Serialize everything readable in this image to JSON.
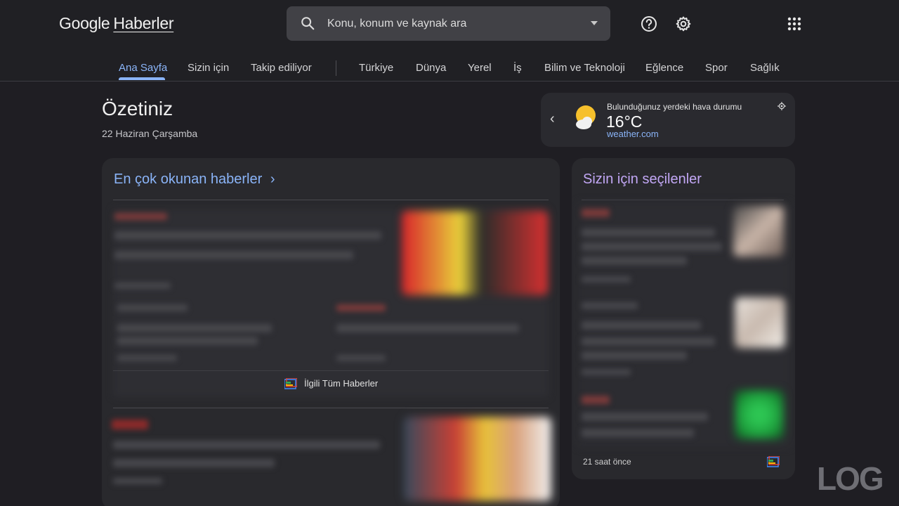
{
  "header": {
    "logo_main": "Google",
    "logo_sub": "Haberler",
    "search_placeholder": "Konu, konum ve kaynak ara",
    "help_icon": "help-circle-icon",
    "settings_icon": "gear-icon",
    "apps_icon": "apps-grid-icon"
  },
  "tabs": [
    {
      "label": "Ana Sayfa",
      "active": true
    },
    {
      "label": "Sizin için"
    },
    {
      "label": "Takip ediliyor"
    },
    {
      "label": "Türkiye"
    },
    {
      "label": "Dünya"
    },
    {
      "label": "Yerel"
    },
    {
      "label": "İş"
    },
    {
      "label": "Bilim ve Teknoloji"
    },
    {
      "label": "Eğlence"
    },
    {
      "label": "Spor"
    },
    {
      "label": "Sağlık"
    }
  ],
  "summary": {
    "title": "Özetiniz",
    "date": "22 Haziran Çarşamba"
  },
  "weather": {
    "label": "Bulunduğunuz yerdeki hava durumu",
    "temperature": "16°C",
    "source": "weather.com",
    "icon": "partly-cloudy-icon"
  },
  "top_news": {
    "title": "En çok okunan haberler",
    "related_label": "İlgili Tüm Haberler"
  },
  "for_you": {
    "title": "Sizin için seçilenler",
    "time": "21 saat önce"
  },
  "watermark": "LOG",
  "colors": {
    "background": "#1f1e23",
    "card": "#29292d",
    "accent_blue": "#8ab4f8",
    "accent_purple": "#c2a7f5"
  }
}
